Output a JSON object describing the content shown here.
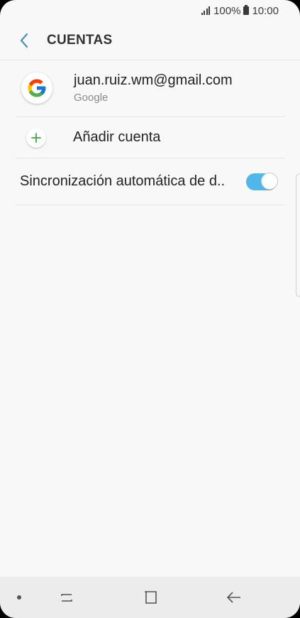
{
  "status_bar": {
    "battery": "100%",
    "time": "10:00",
    "icons": [
      "signal-icon",
      "battery-icon"
    ]
  },
  "header": {
    "back_icon": "chevron-left-icon",
    "title": "CUENTAS"
  },
  "accounts": [
    {
      "icon": "google-icon",
      "email": "juan.ruiz.wm@gmail.com",
      "type": "Google"
    }
  ],
  "add_account": {
    "icon": "plus-icon",
    "label": "Añadir cuenta"
  },
  "sync": {
    "label": "Sincronización automática de d..",
    "enabled": true
  },
  "colors": {
    "accent": "#4fb8e8",
    "back_arrow": "#4a90b8",
    "plus": "#3daa3d"
  },
  "nav_bar": {
    "icons": [
      "dot-icon",
      "recent-apps-icon",
      "home-icon",
      "back-icon"
    ]
  }
}
